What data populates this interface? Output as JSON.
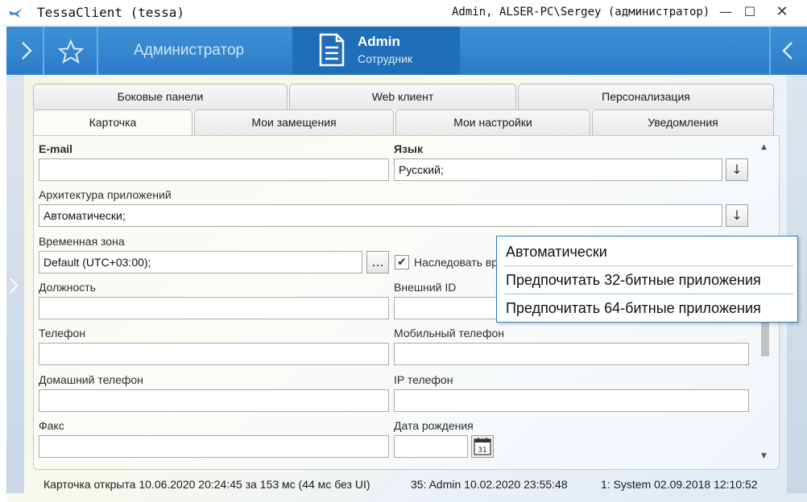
{
  "window": {
    "title": "TessaClient (tessa)",
    "user_info": "Admin, ALSER-PC\\Sergey (администратор)",
    "icons": [
      "tessa-bird-icon",
      "minimize-icon",
      "maximize-icon",
      "close-icon"
    ]
  },
  "header": {
    "section_label": "Администратор",
    "card_title": "Admin",
    "card_subtitle": "Сотрудник",
    "colors": {
      "bar": "#2b7cc8",
      "active_tile": "#1f6fb8"
    }
  },
  "tabs": {
    "row1": [
      "Боковые панели",
      "Web клиент",
      "Персонализация"
    ],
    "row2": [
      "Карточка",
      "Мои замещения",
      "Мои настройки",
      "Уведомления"
    ],
    "active": "Карточка"
  },
  "form": {
    "email": {
      "label": "E-mail",
      "value": ""
    },
    "language": {
      "label": "Язык",
      "value": "Русский;"
    },
    "architecture": {
      "label": "Архитектура приложений",
      "value": "Автоматически;"
    },
    "timezone": {
      "label": "Временная зона",
      "value": "Default (UTC+03:00);",
      "button": "...",
      "inherit_label": "Наследовать вр",
      "inherit_checked": true
    },
    "position": {
      "label": "Должность",
      "value": ""
    },
    "external_id": {
      "label": "Внешний ID",
      "value": ""
    },
    "phone": {
      "label": "Телефон",
      "value": ""
    },
    "mobile": {
      "label": "Мобильный телефон",
      "value": ""
    },
    "home_phone": {
      "label": "Домашний телефон",
      "value": ""
    },
    "ip_phone": {
      "label": "IP телефон",
      "value": ""
    },
    "fax": {
      "label": "Факс",
      "value": ""
    },
    "birthday": {
      "label": "Дата рождения",
      "value": "",
      "calendar_day": "31"
    },
    "select_glyph": "↓",
    "check_glyph": "✔"
  },
  "dropdown": {
    "options": [
      "Автоматически",
      "Предпочитать 32-битные приложения",
      "Предпочитать 64-битные приложения"
    ]
  },
  "statusbar": {
    "opened": "Карточка открыта 10.06.2020 20:24:45 за 153 мс (44 мс без UI)",
    "modified": "35:  Admin  10.02.2020 23:55:48",
    "created": "1:  System  02.09.2018 12:10:52"
  }
}
